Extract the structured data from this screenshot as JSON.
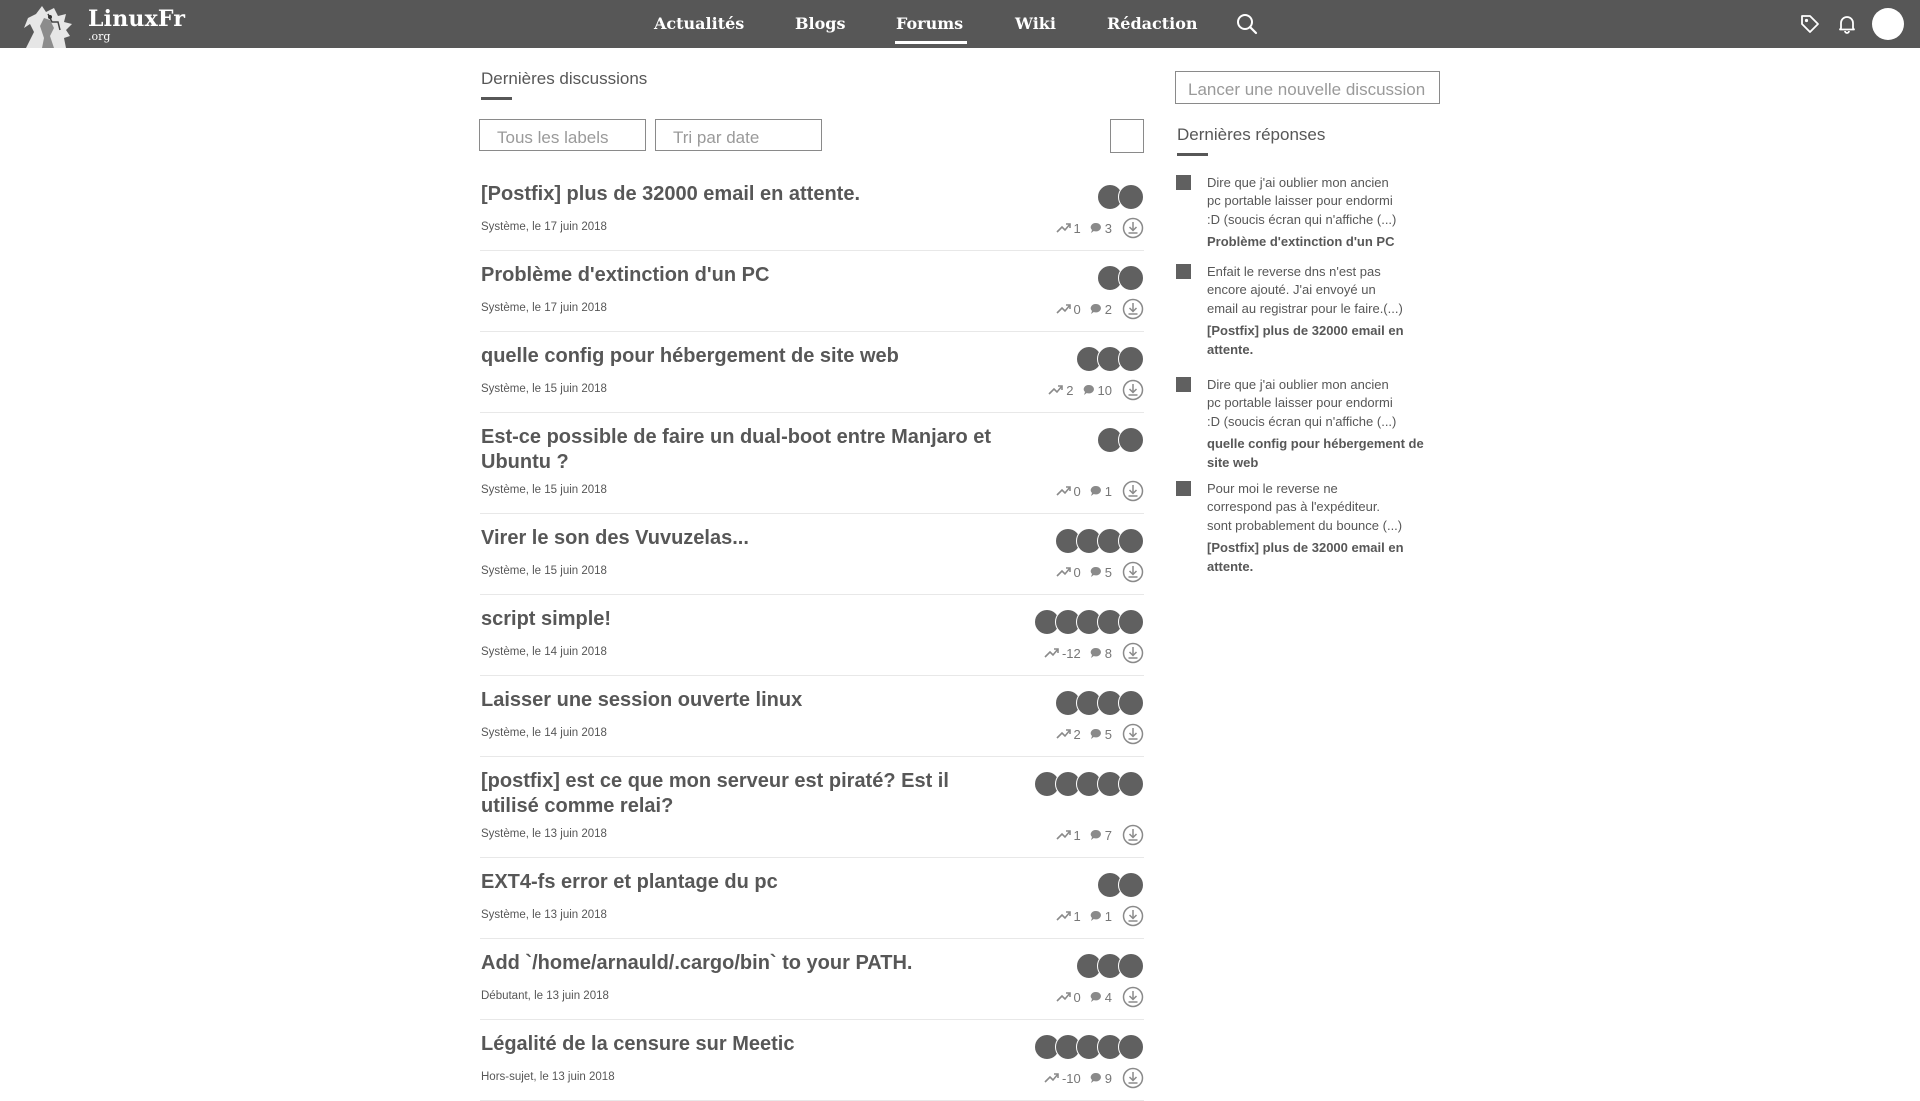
{
  "header": {
    "logo_name": "LinuxFr",
    "logo_tld": ".org",
    "nav": [
      {
        "label": "Actualités"
      },
      {
        "label": "Blogs"
      },
      {
        "label": "Forums"
      },
      {
        "label": "Wiki"
      },
      {
        "label": "Rédaction"
      }
    ],
    "active_nav": "Forums",
    "icons": [
      "search-icon",
      "tag-icon",
      "bell-icon",
      "avatar"
    ]
  },
  "main": {
    "title": "Dernières discussions",
    "filters": {
      "labels": "Tous les labels",
      "sort": "Tri par date"
    },
    "discussions": [
      {
        "title": "[Postfix] plus de 32000 email en attente.",
        "meta": "Système, le 17 juin 2018",
        "score": "1",
        "comments": "3",
        "participants": 2
      },
      {
        "title": "Problème d'extinction d'un PC",
        "meta": "Système, le 17 juin 2018",
        "score": "0",
        "comments": "2",
        "participants": 2
      },
      {
        "title": "quelle config pour hébergement de site web",
        "meta": "Système, le 15 juin 2018",
        "score": "2",
        "comments": "10",
        "participants": 3
      },
      {
        "title": "Est-ce possible de faire un dual-boot entre Manjaro et Ubuntu ?",
        "meta": "Système, le 15 juin 2018",
        "score": "0",
        "comments": "1",
        "participants": 2
      },
      {
        "title": "Virer le son des Vuvuzelas...",
        "meta": "Système, le 15 juin 2018",
        "score": "0",
        "comments": "5",
        "participants": 4
      },
      {
        "title": "script simple!",
        "meta": "Système, le 14 juin 2018",
        "score": "-12",
        "comments": "8",
        "participants": 5
      },
      {
        "title": "Laisser une session ouverte linux",
        "meta": "Système, le 14 juin 2018",
        "score": "2",
        "comments": "5",
        "participants": 4
      },
      {
        "title": "[postfix] est ce que mon serveur est piraté? Est il utilisé comme relai?",
        "meta": "Système, le 13 juin 2018",
        "score": "1",
        "comments": "7",
        "participants": 5
      },
      {
        "title": "EXT4-fs error et plantage du pc",
        "meta": "Système, le 13 juin 2018",
        "score": "1",
        "comments": "1",
        "participants": 2
      },
      {
        "title": "Add `/home/arnauld/.cargo/bin` to your PATH.",
        "meta": "Débutant, le 13 juin 2018",
        "score": "0",
        "comments": "4",
        "participants": 3
      },
      {
        "title": "Légalité de la censure sur Meetic",
        "meta": "Hors-sujet, le 13 juin 2018",
        "score": "-10",
        "comments": "9",
        "participants": 5
      }
    ]
  },
  "sidebar": {
    "new_discussion": "Lancer une nouvelle discussion",
    "title": "Dernières réponses",
    "replies": [
      {
        "text": "Dire que j'ai oublier mon ancien\npc portable laisser pour endormi\n:D (soucis écran qui n'affiche  (...)",
        "topic": "Problème d'extinction d'un PC"
      },
      {
        "text": "Enfait le reverse dns n'est pas\nencore ajouté. J'ai envoyé un\nemail au registrar pour le faire.(...)",
        "topic": "[Postfix] plus de 32000 email en attente."
      },
      {
        "text": "Dire que j'ai oublier mon ancien\npc portable laisser pour endormi\n:D (soucis écran qui n'affiche  (...)",
        "topic": "quelle config pour hébergement de site web"
      },
      {
        "text": "Pour moi le reverse ne\ncorrespond pas à l'expéditeur.\n sont probablement du bounce (...)",
        "topic": "[Postfix] plus de 32000 email en attente."
      }
    ]
  },
  "colors": {
    "topbar": "#575757",
    "text": "#575757",
    "muted": "#9a9a9a",
    "avatar_dot": "#606060"
  }
}
